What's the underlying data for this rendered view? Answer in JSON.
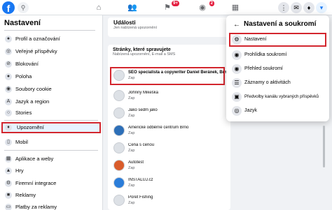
{
  "topbar": {
    "logo": "f",
    "nav_badges": {
      "flag": "9+",
      "groups": "2"
    }
  },
  "sidebar": {
    "title": "Nastavení",
    "items": [
      {
        "label": "Profil a označování",
        "icon": "user-tag-icon"
      },
      {
        "label": "Veřejné příspěvky",
        "icon": "globe-icon"
      },
      {
        "label": "Blokování",
        "icon": "block-icon"
      },
      {
        "label": "Poloha",
        "icon": "location-icon"
      },
      {
        "label": "Soubory cookie",
        "icon": "cookie-icon"
      },
      {
        "label": "Jazyk a region",
        "icon": "language-icon"
      },
      {
        "label": "Stories",
        "icon": "stories-icon"
      },
      {
        "label": "Upozornění",
        "icon": "bell-icon"
      },
      {
        "label": "Mobil",
        "icon": "mobile-icon"
      },
      {
        "label": "Aplikace a weby",
        "icon": "apps-icon"
      },
      {
        "label": "Hry",
        "icon": "games-icon"
      },
      {
        "label": "Firemní integrace",
        "icon": "integration-icon"
      },
      {
        "label": "Reklamy",
        "icon": "ads-icon"
      },
      {
        "label": "Platby za reklamy",
        "icon": "payment-icon"
      }
    ]
  },
  "main": {
    "events": {
      "title": "Události",
      "subtitle": "Jen nabízená upozornění"
    },
    "pages": {
      "title": "Stránky, které spravujete",
      "subtitle": "Nabízená upozornění, E-mail a SMS",
      "rows": [
        {
          "name": "SEO specialista a copywriter Daniel Beránek, Brno",
          "status": "Zap"
        },
        {
          "name": "Johnny Mikeška",
          "status": "Zap"
        },
        {
          "name": "Jako sedm jako",
          "status": "Zap"
        },
        {
          "name": "Americké odběrné centrum Brno",
          "status": "Zap"
        },
        {
          "name": "Cena s cenou",
          "status": "Zap"
        },
        {
          "name": "Autotest",
          "status": "Zap"
        },
        {
          "name": "INSTALUJ.cz",
          "status": "Zap"
        },
        {
          "name": "Poret Fishing",
          "status": "Zap"
        }
      ]
    }
  },
  "dropdown": {
    "title": "Nastavení a soukromí",
    "items": [
      {
        "label": "Nastavení",
        "icon": "gear-icon"
      },
      {
        "label": "Prohlídka soukromí",
        "icon": "lock-icon"
      },
      {
        "label": "Přehled soukromí",
        "icon": "lock-icon"
      },
      {
        "label": "Záznamy o aktivitách",
        "icon": "list-icon"
      },
      {
        "label": "Předvolby kanálu vybraných příspěvků",
        "icon": "feed-icon"
      },
      {
        "label": "Jazyk",
        "icon": "globe-icon"
      }
    ]
  },
  "colors": {
    "brand": "#1877f2",
    "highlight": "#d3262e",
    "badge": "#e41e3f"
  }
}
